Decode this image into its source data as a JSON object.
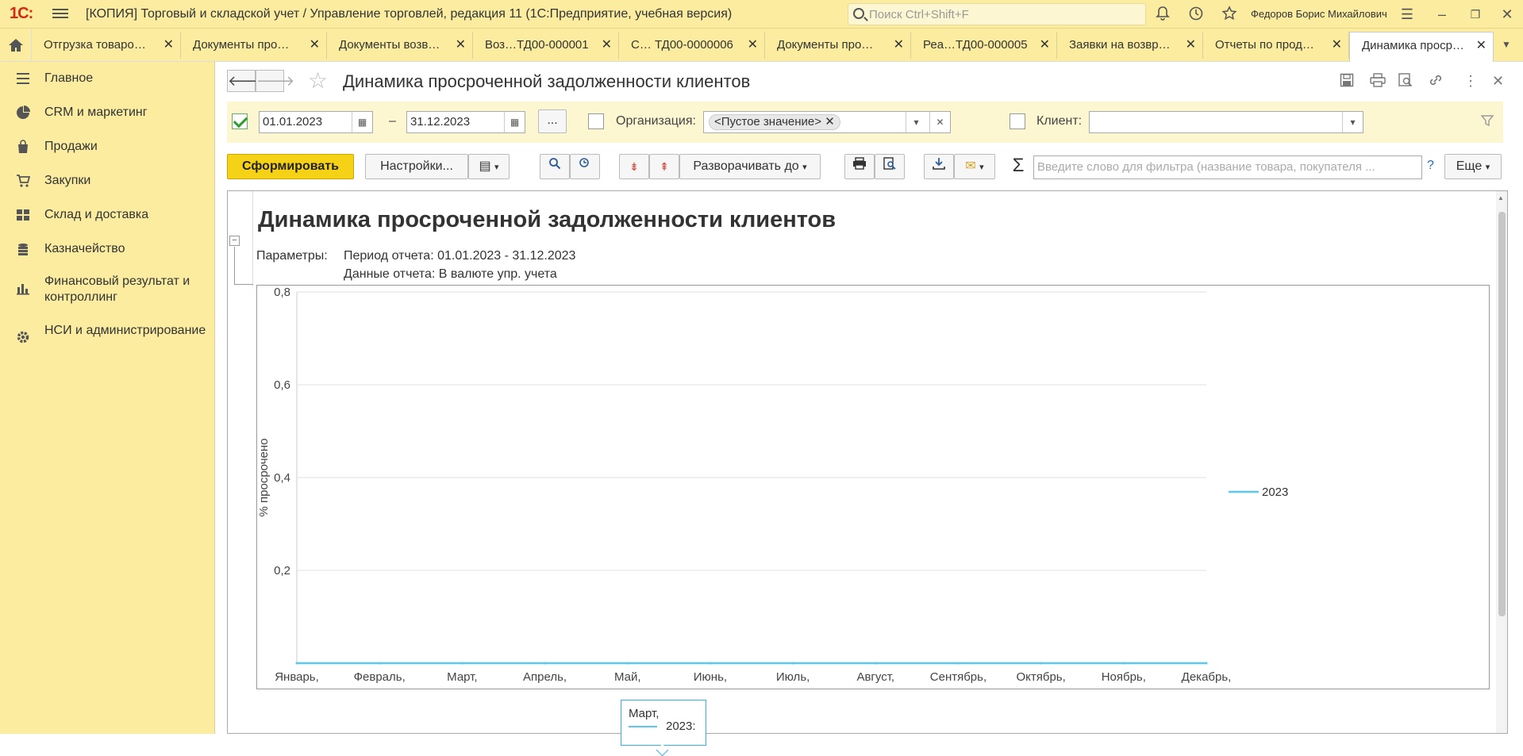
{
  "titlebar": {
    "logo": "1С:",
    "app_title": "[КОПИЯ] Торговый и складской учет / Управление торговлей, редакция 11  (1С:Предприятие, учебная версия)",
    "search_placeholder": "Поиск Ctrl+Shift+F",
    "user": "Федоров Борис Михайлович"
  },
  "tabs": [
    {
      "label": "Отгрузка товаро…"
    },
    {
      "label": "Документы про…"
    },
    {
      "label": "Документы возв…"
    },
    {
      "label": "Воз…ТД00-000001"
    },
    {
      "label": "С… ТД00-0000006"
    },
    {
      "label": "Документы про…"
    },
    {
      "label": "Реа…ТД00-000005"
    },
    {
      "label": "Заявки на возвр…"
    },
    {
      "label": "Отчеты по прод…"
    },
    {
      "label": "Динамика проср…",
      "active": true
    }
  ],
  "sidebar": {
    "items": [
      {
        "label": "Главное",
        "icon": "menu-lines-icon"
      },
      {
        "label": "CRM и маркетинг",
        "icon": "pie-chart-icon"
      },
      {
        "label": "Продажи",
        "icon": "bag-icon"
      },
      {
        "label": "Закупки",
        "icon": "cart-icon"
      },
      {
        "label": "Склад и доставка",
        "icon": "warehouse-icon"
      },
      {
        "label": "Казначейство",
        "icon": "coins-icon"
      },
      {
        "label": "Финансовый результат и контроллинг",
        "icon": "bar-chart-icon"
      },
      {
        "label": "НСИ и администрирование",
        "icon": "gear-icon"
      }
    ]
  },
  "page": {
    "title": "Динамика просроченной задолженности клиентов"
  },
  "filters": {
    "date_from": "01.01.2023",
    "dash": "–",
    "date_to": "31.12.2023",
    "ellipsis": "...",
    "org_label": "Организация:",
    "org_value": "<Пустое значение>",
    "client_label": "Клиент:",
    "client_value": ""
  },
  "toolbar": {
    "generate": "Сформировать",
    "settings": "Настройки...",
    "expand_to": "Разворачивать до",
    "filter_placeholder": "Введите слово для фильтра (название товара, покупателя ...",
    "help": "?",
    "more": "Еще",
    "sigma": "Σ"
  },
  "report": {
    "title": "Динамика просроченной задолженности клиентов",
    "params_label": "Параметры:",
    "params_line1": "Период отчета: 01.01.2023 - 31.12.2023",
    "params_line2": "Данные отчета: В валюте упр. учета"
  },
  "chart_data": {
    "type": "line",
    "title": "",
    "xlabel": "",
    "ylabel": "% просрочено",
    "categories": [
      "Январь,",
      "Февраль,",
      "Март,",
      "Апрель,",
      "Май,",
      "Июнь,",
      "Июль,",
      "Август,",
      "Сентябрь,",
      "Октябрь,",
      "Ноябрь,",
      "Декабрь,"
    ],
    "series": [
      {
        "name": "2023",
        "values": [
          0,
          0,
          0,
          0,
          0,
          0,
          0,
          0,
          0,
          0,
          0,
          0
        ],
        "color": "#5ac8f0"
      }
    ],
    "yticks": [
      "0,2",
      "0,4",
      "0,6",
      "0,8"
    ],
    "ylim": [
      0,
      0.8
    ],
    "grid": true,
    "legend": "right"
  },
  "tooltip": {
    "line1": "Март,",
    "line2": "2023:"
  }
}
